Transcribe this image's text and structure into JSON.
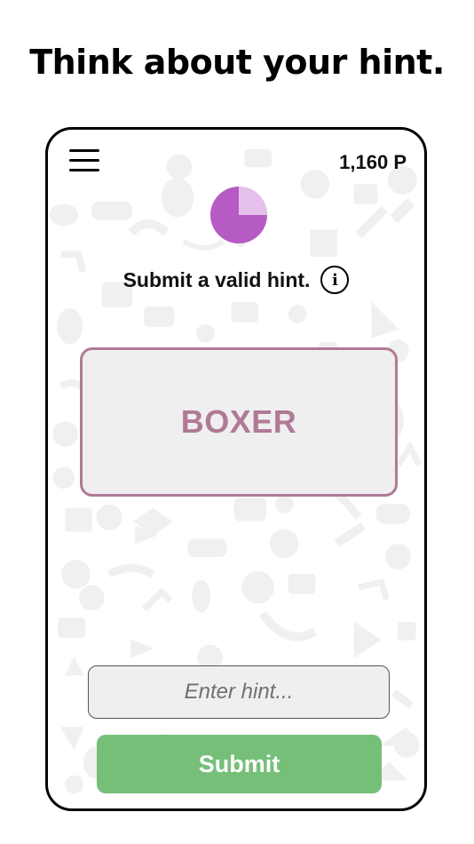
{
  "headline": "Think about your hint.",
  "header": {
    "points": "1,160 P",
    "menu_icon": "hamburger-menu-icon"
  },
  "timer": {
    "remaining_fraction": 0.75,
    "color_remaining": "#b75bc4",
    "color_elapsed": "#e3c1ea"
  },
  "status": {
    "text": "Submit a valid hint.",
    "info_icon_glyph": "i"
  },
  "word_card": {
    "word": "BOXER",
    "border_color": "#b07a96",
    "text_color": "#b07a96"
  },
  "hint_input": {
    "value": "",
    "placeholder": "Enter hint..."
  },
  "submit": {
    "label": "Submit",
    "color": "#76bf79"
  }
}
